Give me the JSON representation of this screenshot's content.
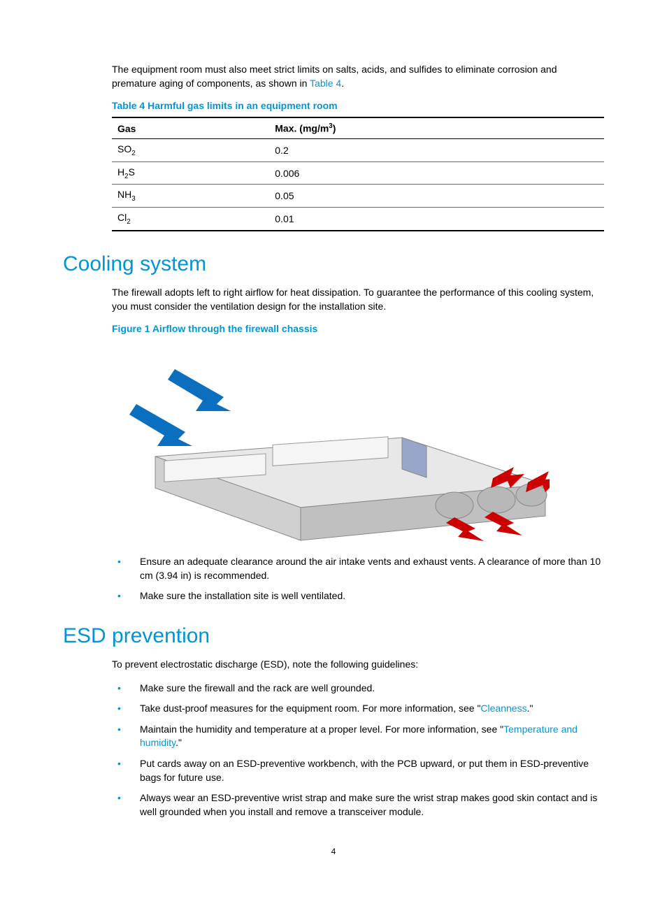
{
  "intro_text_pre": "The equipment room must also meet strict limits on salts, acids, and sulfides to eliminate corrosion and premature aging of components, as shown in ",
  "intro_link": "Table 4",
  "intro_text_post": ".",
  "table4": {
    "caption": "Table 4 Harmful gas limits in an equipment room",
    "col_gas": "Gas",
    "col_max_pre": "Max. (mg/m",
    "col_max_sup": "3",
    "col_max_post": ")",
    "rows": [
      {
        "gas_pre": "SO",
        "gas_sub": "2",
        "max": "0.2"
      },
      {
        "gas_pre": "H",
        "gas_sub": "2",
        "gas_post": "S",
        "max": "0.006"
      },
      {
        "gas_pre": "NH",
        "gas_sub": "3",
        "max": "0.05"
      },
      {
        "gas_pre": "Cl",
        "gas_sub": "2",
        "max": "0.01"
      }
    ]
  },
  "chart_data": {
    "type": "table",
    "title": "Table 4 Harmful gas limits in an equipment room",
    "columns": [
      "Gas",
      "Max. (mg/m^3)"
    ],
    "rows": [
      [
        "SO2",
        0.2
      ],
      [
        "H2S",
        0.006
      ],
      [
        "NH3",
        0.05
      ],
      [
        "Cl2",
        0.01
      ]
    ]
  },
  "cooling": {
    "heading": "Cooling system",
    "para": "The firewall adopts left to right airflow for heat dissipation. To guarantee the performance of this cooling system, you must consider the ventilation design for the installation site.",
    "figure_caption": "Figure 1 Airflow through the firewall chassis",
    "figure_alt": "Isometric illustration of a 2U firewall chassis with blue arrows entering the left side (intake) and red arrows exiting the right side fans (exhaust).",
    "bullets": [
      "Ensure an adequate clearance around the air intake vents and exhaust vents. A clearance of more than 10 cm (3.94 in) is recommended.",
      "Make sure the installation site is well ventilated."
    ]
  },
  "esd": {
    "heading": "ESD prevention",
    "intro": "To prevent electrostatic discharge (ESD), note the following guidelines:",
    "bullets": [
      {
        "text": "Make sure the firewall and the rack are well grounded."
      },
      {
        "pre": "Take dust-proof measures for the equipment room. For more information, see \"",
        "link": "Cleanness",
        "post": ".\""
      },
      {
        "pre": "Maintain the humidity and temperature at a proper level. For more information, see \"",
        "link": "Temperature and humidity",
        "post": ".\""
      },
      {
        "text": "Put cards away on an ESD-preventive workbench, with the PCB upward, or put them in ESD-preventive bags for future use."
      },
      {
        "text": "Always wear an ESD-preventive wrist strap and make sure the wrist strap makes good skin contact and is well grounded when you install and remove a transceiver module."
      }
    ]
  },
  "page_number": "4"
}
